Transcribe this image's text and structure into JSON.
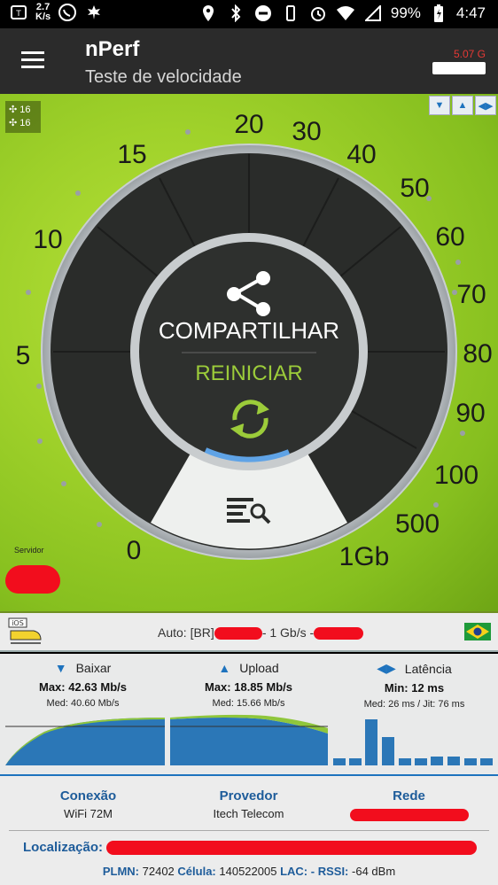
{
  "status_bar": {
    "net_speed_value": "2.7",
    "net_speed_unit": "K/s",
    "battery": "99%",
    "time": "4:47"
  },
  "app_bar": {
    "title": "nPerf",
    "subtitle": "Teste de velocidade",
    "data_used": "5.07 G"
  },
  "gauge": {
    "connections_up": "16",
    "connections_down": "16",
    "scale_labels": [
      "0",
      "5",
      "10",
      "15",
      "20",
      "30",
      "40",
      "50",
      "60",
      "70",
      "80",
      "90",
      "100",
      "500",
      "1Gb"
    ],
    "share_label": "COMPARTILHAR",
    "restart_label": "REINICIAR",
    "server_label": "Servidor"
  },
  "server": {
    "prefix": "Auto: [BR]",
    "speed": "- 1 Gb/s -",
    "ios_badge": "iOS"
  },
  "results": {
    "download": {
      "title": "Baixar",
      "max": "Max: 42.63 Mb/s",
      "med": "Med: 40.60 Mb/s"
    },
    "upload": {
      "title": "Upload",
      "max": "Max: 18.85 Mb/s",
      "med": "Med: 15.66 Mb/s"
    },
    "latency": {
      "title": "Latência",
      "min": "Min: 12 ms",
      "med": "Med: 26 ms / Jit: 76 ms"
    }
  },
  "footer": {
    "connection_label": "Conexão",
    "connection_value": "WiFi 72M",
    "provider_label": "Provedor",
    "provider_value": "Itech Telecom",
    "network_label": "Rede",
    "location_label": "Localização:",
    "plmn_label": "PLMN:",
    "plmn_value": "72402",
    "cell_label": "Célula:",
    "cell_value": "140522005",
    "lac_label": "LAC:",
    "lac_value": "-",
    "rssi_label": "RSSI:",
    "rssi_value": "-64 dBm"
  },
  "colors": {
    "accent_blue": "#1e73be",
    "gauge_green": "#9fd12a",
    "redaction": "#f20d1d"
  }
}
